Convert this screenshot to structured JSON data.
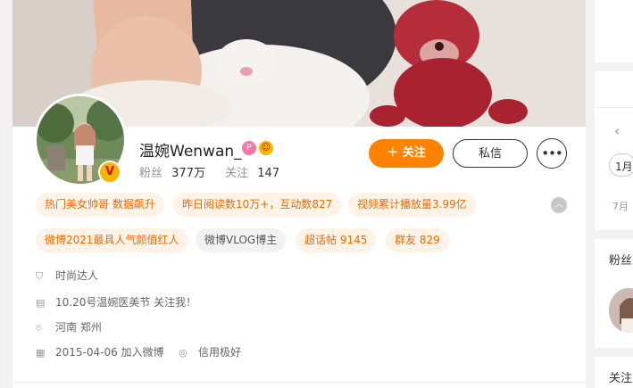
{
  "profile": {
    "name": "温婉Wenwan_",
    "verified_badge_icon": "v-verified-icon",
    "name_badges": [
      "pink-level-icon",
      "emoji-badge-icon"
    ],
    "fans_label": "粉丝",
    "fans_count": "377万",
    "following_label": "关注",
    "following_count": "147"
  },
  "actions": {
    "follow_label": "＋ 关注",
    "message_label": "私信",
    "more_label": "•••"
  },
  "tags": [
    {
      "label": "热门美女帅哥 数据飙升",
      "style": "orange"
    },
    {
      "label": "昨日阅读数10万+，互动数827",
      "style": "orange"
    },
    {
      "label": "视频累计播放量3.99亿",
      "style": "orange"
    },
    {
      "label": "微博2021最具人气颜值红人",
      "style": "orange"
    },
    {
      "label": "微博VLOG博主",
      "style": "gray"
    },
    {
      "label": "超话帖 9145",
      "style": "orange"
    },
    {
      "label": "群友 829",
      "style": "orange"
    }
  ],
  "collapse_icon": "chevron-up-icon",
  "info": [
    {
      "icon": "shield-icon",
      "text": "时尚达人"
    },
    {
      "icon": "document-icon",
      "text": "10.20号温婉医美节 关注我！"
    },
    {
      "icon": "location-icon",
      "text": "河南 郑州"
    },
    {
      "icon": "calendar-icon",
      "text": "2015-04-06 加入微博"
    },
    {
      "icon": "credit-icon",
      "text": "信用极好"
    }
  ],
  "right": {
    "arrow_left": "‹",
    "month_current": "1月",
    "month_next": "7月",
    "fans_title": "粉丝",
    "follow_title": "关注"
  },
  "colors": {
    "accent": "#ff8200",
    "tag_bg": "#fff2e6",
    "tag_text": "#ee6a00"
  }
}
